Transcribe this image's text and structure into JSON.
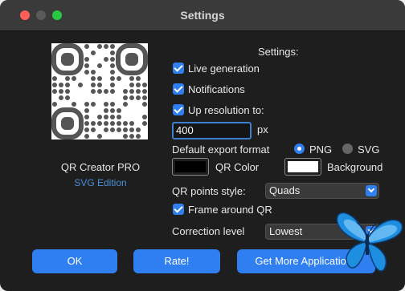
{
  "window": {
    "title": "Settings"
  },
  "app": {
    "name": "QR Creator PRO",
    "edition": "SVG Edition"
  },
  "settings": {
    "heading": "Settings:",
    "live_generation": {
      "label": "Live generation",
      "checked": true
    },
    "notifications": {
      "label": "Notifications",
      "checked": true
    },
    "up_resolution": {
      "label": "Up resolution to:",
      "checked": true,
      "value": "400",
      "unit": "px"
    },
    "export_format": {
      "label": "Default export format",
      "options": [
        "PNG",
        "SVG"
      ],
      "selected": "PNG"
    },
    "qr_color": {
      "label": "QR Color",
      "color": "#000000"
    },
    "background": {
      "label": "Background",
      "color": "#ffffff"
    },
    "points_style": {
      "label": "QR points style:",
      "value": "Quads"
    },
    "frame": {
      "label": "Frame around QR",
      "checked": true
    },
    "correction": {
      "label": "Correction level",
      "value": "Lowest"
    }
  },
  "buttons": {
    "ok": "OK",
    "rate": "Rate!",
    "more": "Get More Applications"
  },
  "colors": {
    "accent": "#2f7ff0",
    "link": "#4a8fd6",
    "window_bg": "#1e1e1e"
  }
}
